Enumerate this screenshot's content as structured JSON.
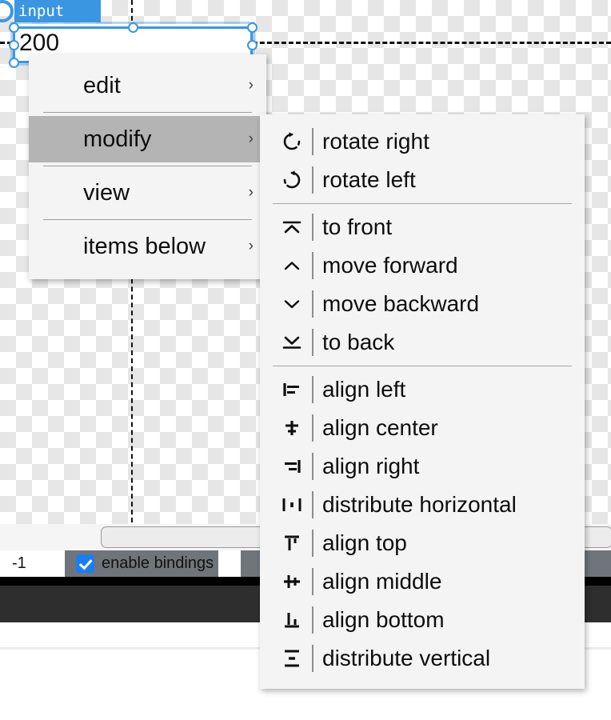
{
  "canvas": {
    "object": {
      "label": "input",
      "value": "200"
    }
  },
  "statusbar": {
    "number_field_value": "-1",
    "checkbox_label": "enable bindings",
    "checkbox_checked": true
  },
  "context_menu": {
    "items": [
      {
        "label": "edit",
        "arrow": "›",
        "highlighted": false
      },
      {
        "label": "modify",
        "arrow": "›",
        "highlighted": true
      },
      {
        "label": "view",
        "arrow": "›",
        "highlighted": false
      },
      {
        "label": "items below",
        "arrow": "›",
        "highlighted": false
      }
    ]
  },
  "submenu": {
    "groups": [
      {
        "items": [
          {
            "label": "rotate right",
            "icon": "rotate-right-icon"
          },
          {
            "label": "rotate left",
            "icon": "rotate-left-icon"
          }
        ]
      },
      {
        "items": [
          {
            "label": "to front",
            "icon": "to-front-icon"
          },
          {
            "label": "move forward",
            "icon": "move-forward-icon"
          },
          {
            "label": "move backward",
            "icon": "move-backward-icon"
          },
          {
            "label": "to back",
            "icon": "to-back-icon"
          }
        ]
      },
      {
        "items": [
          {
            "label": "align left",
            "icon": "align-left-icon"
          },
          {
            "label": "align center",
            "icon": "align-center-icon"
          },
          {
            "label": "align right",
            "icon": "align-right-icon"
          },
          {
            "label": "distribute horizontal",
            "icon": "distribute-horizontal-icon"
          },
          {
            "label": "align top",
            "icon": "align-top-icon"
          },
          {
            "label": "align middle",
            "icon": "align-middle-icon"
          },
          {
            "label": "align bottom",
            "icon": "align-bottom-icon"
          },
          {
            "label": "distribute vertical",
            "icon": "distribute-vertical-icon"
          }
        ]
      }
    ]
  },
  "colors": {
    "selection_blue": "#3b96e2",
    "checkbox_blue": "#1a7ef1",
    "menu_bg": "#f4f4f4",
    "menu_highlight": "#b4b4b4",
    "statusbar_bg": "#6f757a",
    "dark_panel": "#2e2e2e"
  }
}
